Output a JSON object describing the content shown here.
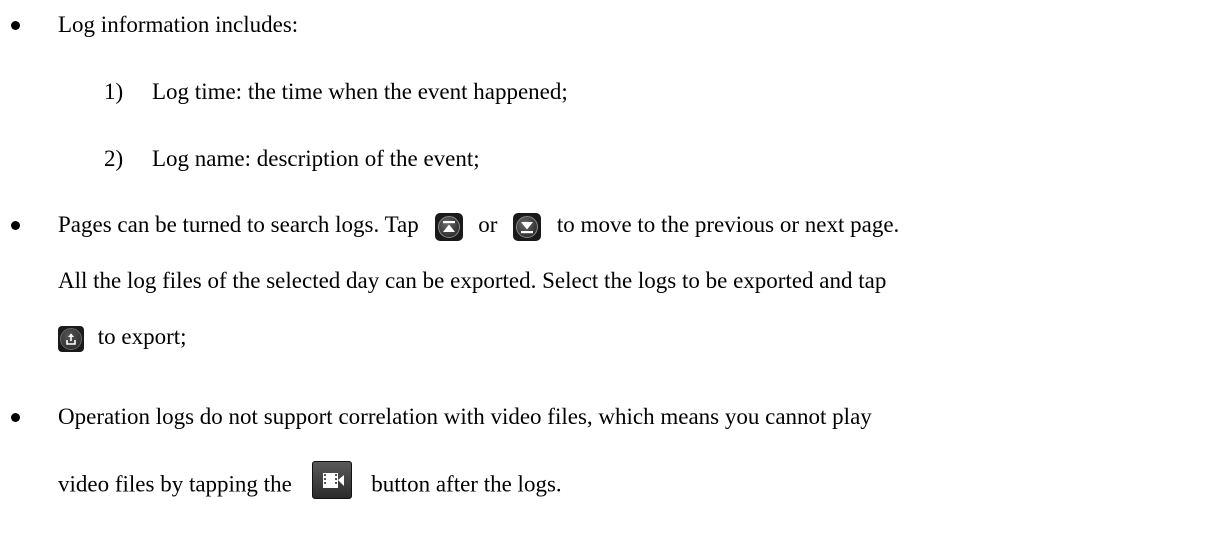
{
  "items": [
    {
      "text": "Log information includes:"
    },
    {
      "number": "1)",
      "text": "Log time: the time when the event happened;"
    },
    {
      "number": "2)",
      "text": "Log name: description of the event;"
    },
    {
      "text_before": "Pages can be turned to search logs. Tap",
      "between": "or",
      "text_after": "to move to the previous or next page."
    },
    {
      "text": "All the log files of the selected day can be exported. Select the logs to be exported and tap"
    },
    {
      "text_after": "to export;"
    },
    {
      "text": "Operation logs do not support correlation with video files, which means you cannot play"
    },
    {
      "text_before": "video files by tapping the",
      "text_after": "button after the logs."
    }
  ],
  "icons": {
    "prev_page": "page-up-icon",
    "next_page": "page-down-icon",
    "export": "export-icon",
    "video": "video-playback-icon"
  }
}
